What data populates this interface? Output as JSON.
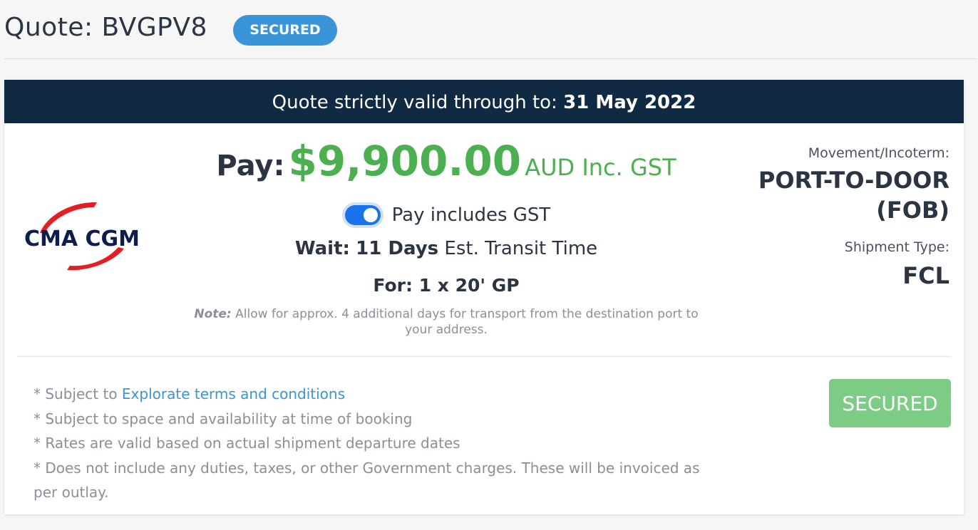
{
  "header": {
    "title": "Quote: BVGPV8",
    "badge": "SECURED"
  },
  "banner": {
    "prefix": "Quote strictly valid through to:",
    "date": "31 May 2022"
  },
  "carrier": {
    "name": "CMA CGM"
  },
  "pricing": {
    "pay_label": "Pay:",
    "amount": "$9,900.00",
    "currency_label": "AUD Inc. GST",
    "gst_toggle_label": "Pay includes GST",
    "gst_toggle_on": true
  },
  "transit": {
    "wait_label": "Wait:",
    "days": "11 Days",
    "suffix": "Est. Transit Time"
  },
  "container": {
    "label": "For:",
    "value": "1 x 20' GP"
  },
  "note": {
    "label": "Note:",
    "text": "Allow for approx. 4 additional days for transport from the destination port to your address."
  },
  "details": {
    "movement_label": "Movement/Incoterm:",
    "movement_value_line1": "PORT-TO-DOOR",
    "movement_value_line2": "(FOB)",
    "shipment_label": "Shipment Type:",
    "shipment_value": "FCL"
  },
  "terms": {
    "prefix": "* Subject to",
    "link": "Explorate terms and conditions",
    "items": [
      "* Subject to space and availability at time of booking",
      "* Rates are valid based on actual shipment departure dates",
      "* Does not include any duties, taxes, or other Government charges. These will be invoiced as per outlay."
    ]
  },
  "action": {
    "button_label": "SECURED"
  },
  "colors": {
    "banner_bg": "#0f2a42",
    "price_green": "#4caf50",
    "badge_blue": "#3a95d8",
    "button_green": "#7dcc85",
    "logo_red": "#e31e24",
    "logo_navy": "#0d1e4c"
  }
}
